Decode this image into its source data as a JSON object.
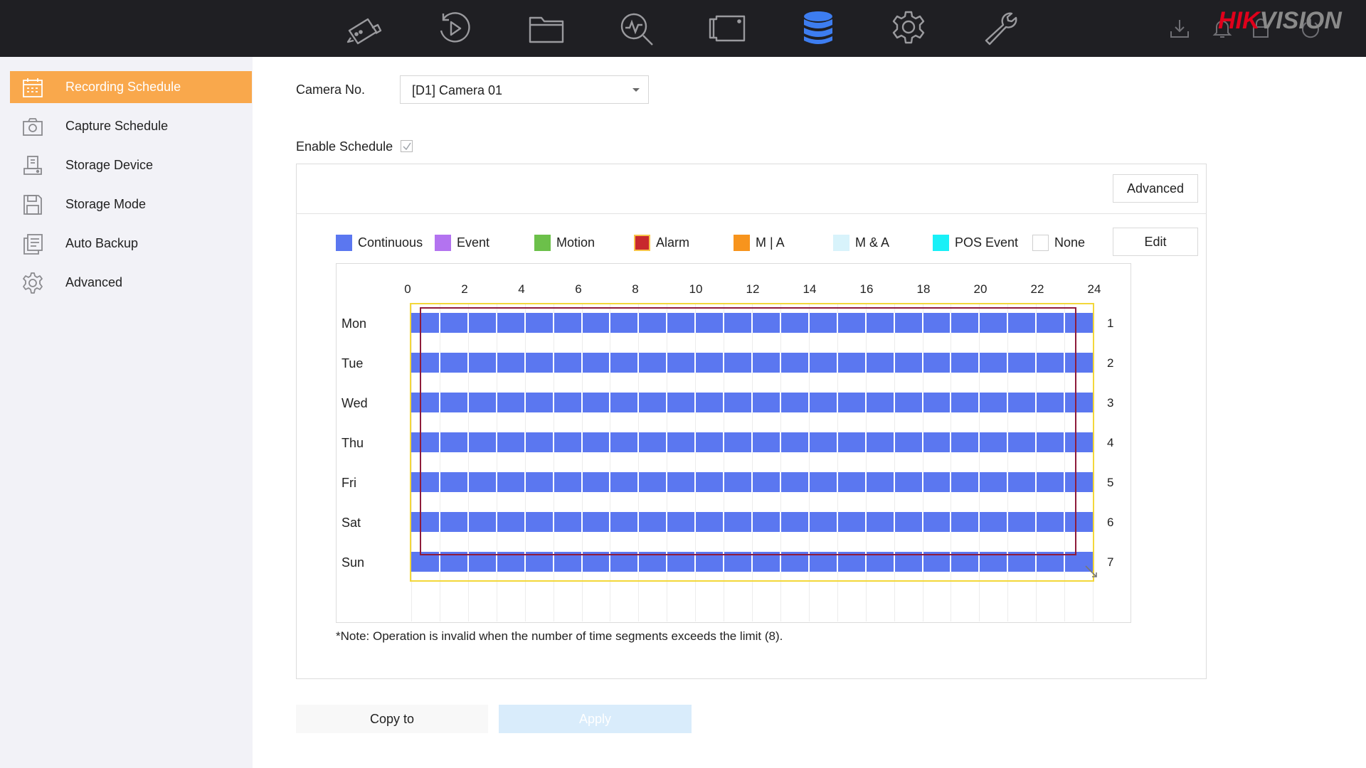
{
  "brand": {
    "part1": "HIK",
    "part2": "VISION"
  },
  "top_nav": [
    {
      "icon": "camera-icon"
    },
    {
      "icon": "playback-icon"
    },
    {
      "icon": "folder-icon"
    },
    {
      "icon": "search-analytics-icon"
    },
    {
      "icon": "video-window-icon"
    },
    {
      "icon": "storage-icon",
      "active": true
    },
    {
      "icon": "settings-icon"
    },
    {
      "icon": "maintenance-icon"
    }
  ],
  "sidebar": {
    "items": [
      {
        "label": "Recording Schedule",
        "icon": "calendar-icon",
        "active": true
      },
      {
        "label": "Capture Schedule",
        "icon": "capture-camera-icon"
      },
      {
        "label": "Storage Device",
        "icon": "hdd-icon"
      },
      {
        "label": "Storage Mode",
        "icon": "floppy-icon"
      },
      {
        "label": "Auto Backup",
        "icon": "backup-icon"
      },
      {
        "label": "Advanced",
        "icon": "gear-icon"
      }
    ]
  },
  "form": {
    "camera_label": "Camera No.",
    "camera_value": "[D1] Camera 01",
    "enable_label": "Enable Schedule",
    "enable_checked": true
  },
  "buttons": {
    "advanced": "Advanced",
    "edit": "Edit",
    "copy_to": "Copy to",
    "apply": "Apply"
  },
  "legend": [
    {
      "label": "Continuous",
      "color": "#5b77f0"
    },
    {
      "label": "Event",
      "color": "#b373f0"
    },
    {
      "label": "Motion",
      "color": "#6cc04a"
    },
    {
      "label": "Alarm",
      "color": "#c8282d"
    },
    {
      "label": "M | A",
      "color": "#f7941d"
    },
    {
      "label": "M & A",
      "color": "#d8f3fb"
    },
    {
      "label": "POS Event",
      "color": "#19f0f7"
    },
    {
      "label": "None",
      "color": "#ffffff"
    }
  ],
  "schedule": {
    "hour_labels": [
      "0",
      "2",
      "4",
      "6",
      "8",
      "10",
      "12",
      "14",
      "16",
      "18",
      "20",
      "22",
      "24"
    ],
    "days": [
      {
        "day": "Mon",
        "num": "1",
        "start": 0,
        "end": 24,
        "type": "Continuous"
      },
      {
        "day": "Tue",
        "num": "2",
        "start": 0,
        "end": 24,
        "type": "Continuous"
      },
      {
        "day": "Wed",
        "num": "3",
        "start": 0,
        "end": 24,
        "type": "Continuous"
      },
      {
        "day": "Thu",
        "num": "4",
        "start": 0,
        "end": 24,
        "type": "Continuous"
      },
      {
        "day": "Fri",
        "num": "5",
        "start": 0,
        "end": 24,
        "type": "Continuous"
      },
      {
        "day": "Sat",
        "num": "6",
        "start": 0,
        "end": 24,
        "type": "Continuous"
      },
      {
        "day": "Sun",
        "num": "7",
        "start": 0,
        "end": 24,
        "type": "Continuous"
      }
    ]
  },
  "note": "*Note: Operation is invalid when the number of time segments exceeds the limit (8)."
}
